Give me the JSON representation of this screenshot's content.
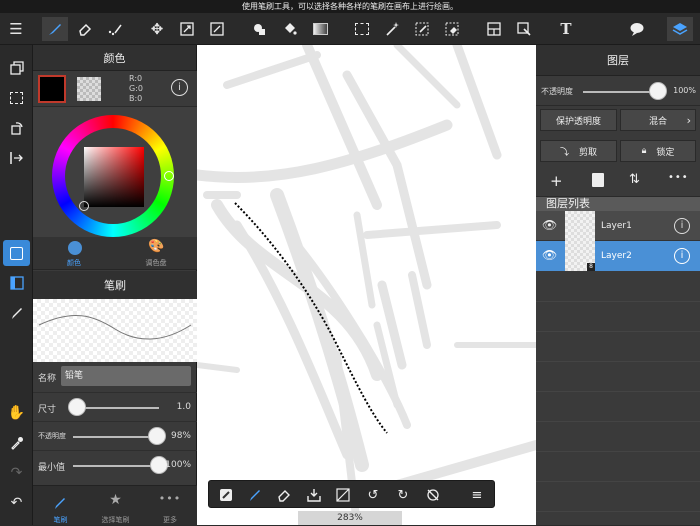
{
  "tooltip": "使用笔刷工具，可以选择各种各样的笔刷在画布上进行绘画。",
  "colors": {
    "accent": "#4aa3ff",
    "selected_layer": "#4a90d6",
    "current_color": "#000000"
  },
  "left_panel": {
    "color_title": "颜色",
    "rgb": {
      "r": "R:0",
      "g": "G:0",
      "b": "B:0"
    },
    "tab_color": "颜色",
    "tab_palette": "调色盘",
    "brush_title": "笔刷",
    "name_label": "名称",
    "name_value": "铅笔",
    "size_label": "尺寸",
    "size_value": "1.0",
    "size_fraction": 0.05,
    "opacity_label": "不透明度",
    "opacity_value": "98%",
    "opacity_fraction": 0.98,
    "min_label": "最小值",
    "min_value": "100%",
    "min_fraction": 1.0,
    "bottom_tabs": [
      "笔刷",
      "选择笔刷",
      "更多"
    ]
  },
  "right_panel": {
    "title": "图层",
    "opacity_label": "不透明度",
    "opacity_value": "100%",
    "opacity_fraction": 1.0,
    "protect_label": "保护透明度",
    "blend_label": "混合",
    "clip_label": "剪取",
    "lock_label": "锁定",
    "list_title": "图层列表",
    "layers": [
      {
        "name": "Layer1",
        "selected": false
      },
      {
        "name": "Layer2",
        "selected": true,
        "badge": "8"
      }
    ]
  },
  "zoom": "283%"
}
